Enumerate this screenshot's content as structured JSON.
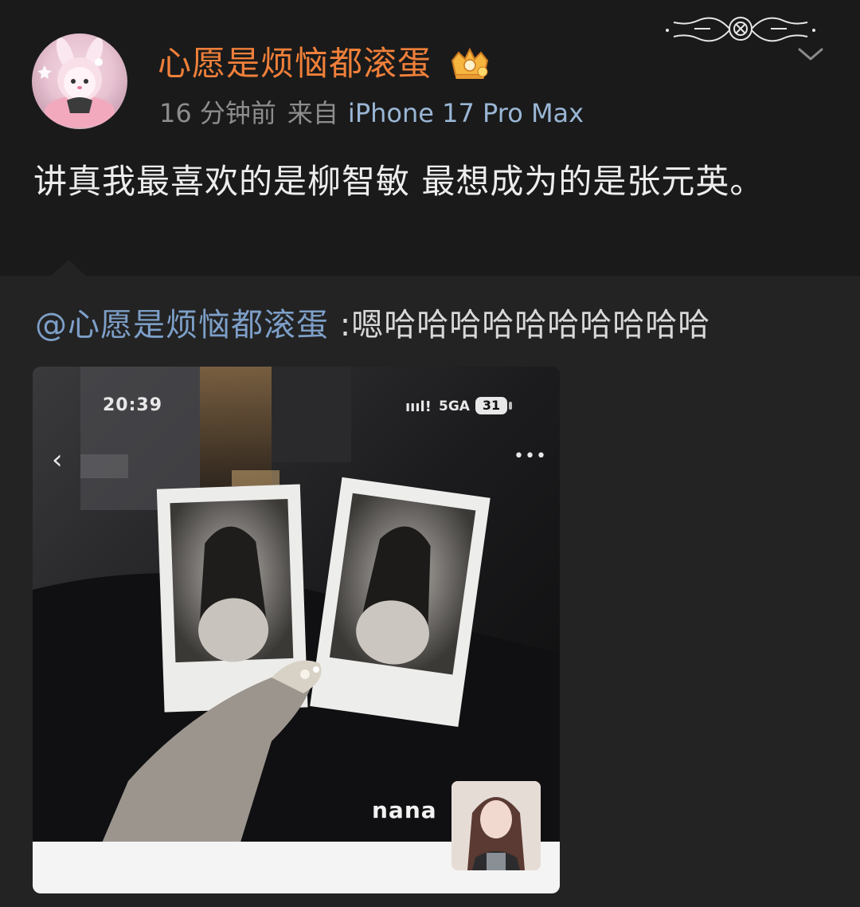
{
  "post": {
    "author": "心愿是烦恼都滚蛋",
    "time": "16 分钟前",
    "from_label": "来自",
    "device": "iPhone 17 Pro Max",
    "text": "讲真我最喜欢的是柳智敏 最想成为的是张元英。"
  },
  "repost": {
    "mention": "@心愿是烦恼都滚蛋",
    "text": " :嗯哈哈哈哈哈哈哈哈哈哈"
  },
  "embedded_image": {
    "status_time": "20:39",
    "signal": "ıııl!",
    "network": "5GA",
    "battery": "31",
    "back_icon": "‹",
    "more_icon": "•••",
    "caption": "nana"
  },
  "colors": {
    "background": "#1a1a1a",
    "repost_background": "#232323",
    "username": "#f0803a",
    "link": "#7d9fc8",
    "meta": "#8d8d8d"
  },
  "icons": [
    "vip-crown-icon",
    "ornament-decoration",
    "chevron-down-icon",
    "back-arrow-icon",
    "more-dots-icon"
  ]
}
